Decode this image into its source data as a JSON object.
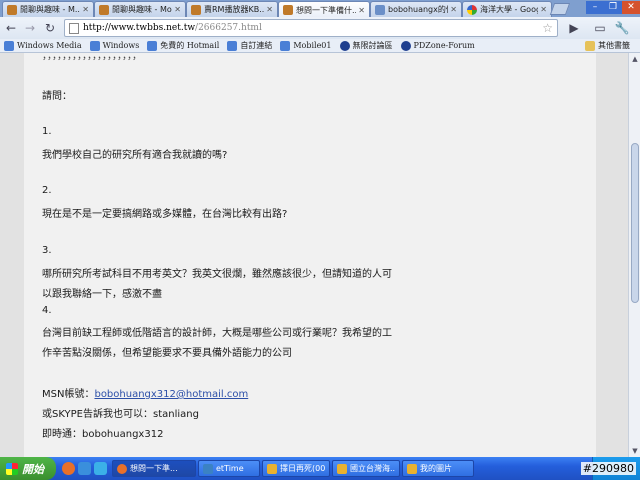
{
  "tabs": [
    {
      "label": "閒聊與趣味 - M...",
      "icon": "forum-page-icon",
      "active": false
    },
    {
      "label": "閒聊與趣味 - Mo...",
      "icon": "forum-page-icon",
      "active": false
    },
    {
      "label": "賣RM播放器KB...",
      "icon": "forum-page-icon",
      "active": false
    },
    {
      "label": "想問一下準備什...",
      "icon": "forum-page-icon",
      "active": true
    },
    {
      "label": "bobohuangx的個...",
      "icon": "document-icon",
      "active": false
    },
    {
      "label": "海洋大學 - Goog...",
      "icon": "google-icon",
      "active": false
    }
  ],
  "url": {
    "host": "http://www.twbbs.net.tw",
    "path": "/2666257.html"
  },
  "bookmarks": [
    {
      "label": "Windows Media",
      "color": "#4a7fd6"
    },
    {
      "label": "Windows",
      "color": "#4a7fd6"
    },
    {
      "label": "免費的 Hotmail",
      "color": "#4a7fd6"
    },
    {
      "label": "自訂連結",
      "color": "#4a7fd6"
    },
    {
      "label": "Mobile01",
      "color": "#4a7fd6"
    },
    {
      "label": "無限討論區",
      "color": "#1f3f8f"
    },
    {
      "label": "PDZone-Forum",
      "color": "#1f3f8f"
    }
  ],
  "other_bookmarks": "其他書籤",
  "post": {
    "top_partial": "，，，，，，，，，，，，，，，，，，，",
    "ask": "請問：",
    "q1_num": "1.",
    "q1": "我們學校自己的研究所有適合我就讀的嗎?",
    "q2_num": "2.",
    "q2": "現在是不是一定要搞網路或多媒體，在台灣比較有出路?",
    "q3_num": "3.",
    "q3_line1": "哪所研究所考試科目不用考英文？我英文很爛，雖然應該很少，但請知道的人可",
    "q3_line2": "以跟我聯絡一下，感激不盡",
    "q4_num": "4.",
    "q4_line1": "台灣目前缺工程師或低階語言的設計師，大概是哪些公司或行業呢？我希望的工",
    "q4_line2": "作辛苦點沒關係，但希望能要求不要具備外語能力的公司",
    "msn_label": "MSN帳號：",
    "msn_value": "bobohuangx312@hotmail.com",
    "skype": "或SKYPE告訴我也可以：stanliang",
    "im": "即時通：bobohuangx312"
  },
  "taskbar": {
    "start_label": "開始",
    "tasks": [
      {
        "label": "想問一下準...",
        "active": true,
        "color": "#e8702a"
      },
      {
        "label": "etTime",
        "active": false,
        "color": "#3b82c4"
      },
      {
        "label": "擇日再死(00...",
        "active": false,
        "color": "#e8b130"
      },
      {
        "label": "國立台灣海...",
        "active": false,
        "color": "#e8b130"
      },
      {
        "label": "我的圖片",
        "active": false,
        "color": "#e8b130"
      }
    ]
  },
  "watermark": "#290980"
}
